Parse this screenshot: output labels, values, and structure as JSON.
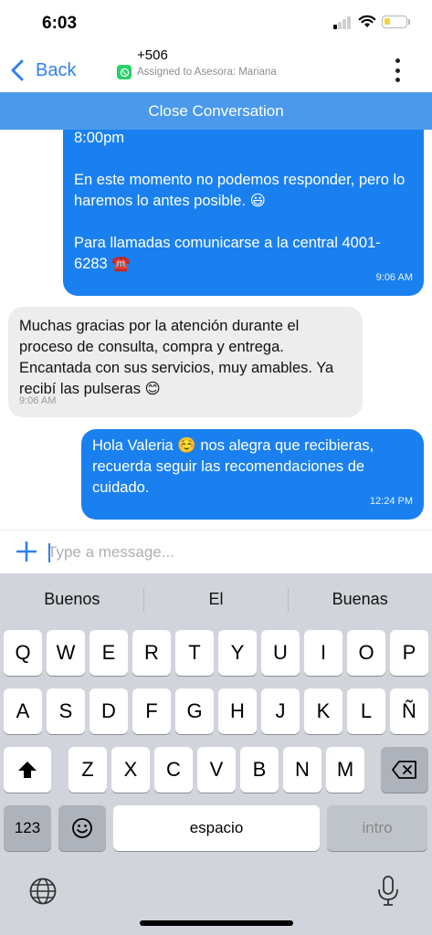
{
  "status_bar": {
    "time": "6:03"
  },
  "header": {
    "back_label": "Back",
    "contact": "+506",
    "assigned": "Assigned to Asesora: Mariana"
  },
  "close_bar": {
    "label": "Close Conversation"
  },
  "messages": [
    {
      "direction": "outgoing",
      "paragraphs": [
        "8:00pm",
        "En este momento no podemos responder, pero lo haremos lo antes posible. 😃",
        "Para llamadas comunicarse a la central 4001-6283 ☎️"
      ],
      "time": "9:06 AM"
    },
    {
      "direction": "incoming",
      "text": "Muchas gracias por la atención durante el proceso de consulta, compra y entrega. Encantada con sus servicios, muy amables. Ya recibí las pulseras 😊",
      "time": "9:06 AM"
    },
    {
      "direction": "outgoing",
      "text": "Hola Valeria ☺️ nos alegra que recibieras, recuerda seguir las recomendaciones de cuidado.",
      "time": "12:24 PM"
    }
  ],
  "composer": {
    "placeholder": "Type a message..."
  },
  "keyboard": {
    "suggestions": [
      "Buenos",
      "El",
      "Buenas"
    ],
    "row1": [
      "Q",
      "W",
      "E",
      "R",
      "T",
      "Y",
      "U",
      "I",
      "O",
      "P"
    ],
    "row2": [
      "A",
      "S",
      "D",
      "F",
      "G",
      "H",
      "J",
      "K",
      "L",
      "Ñ"
    ],
    "row3": [
      "Z",
      "X",
      "C",
      "V",
      "B",
      "N",
      "M"
    ],
    "numbers_key": "123",
    "space_key": "espacio",
    "return_key": "intro"
  },
  "colors": {
    "accent": "#2f7ff2",
    "close_bar": "#4a99ea",
    "outgoing_bubble": "#1a80f0",
    "incoming_bubble": "#ededed",
    "keyboard_bg": "#d1d4da"
  }
}
